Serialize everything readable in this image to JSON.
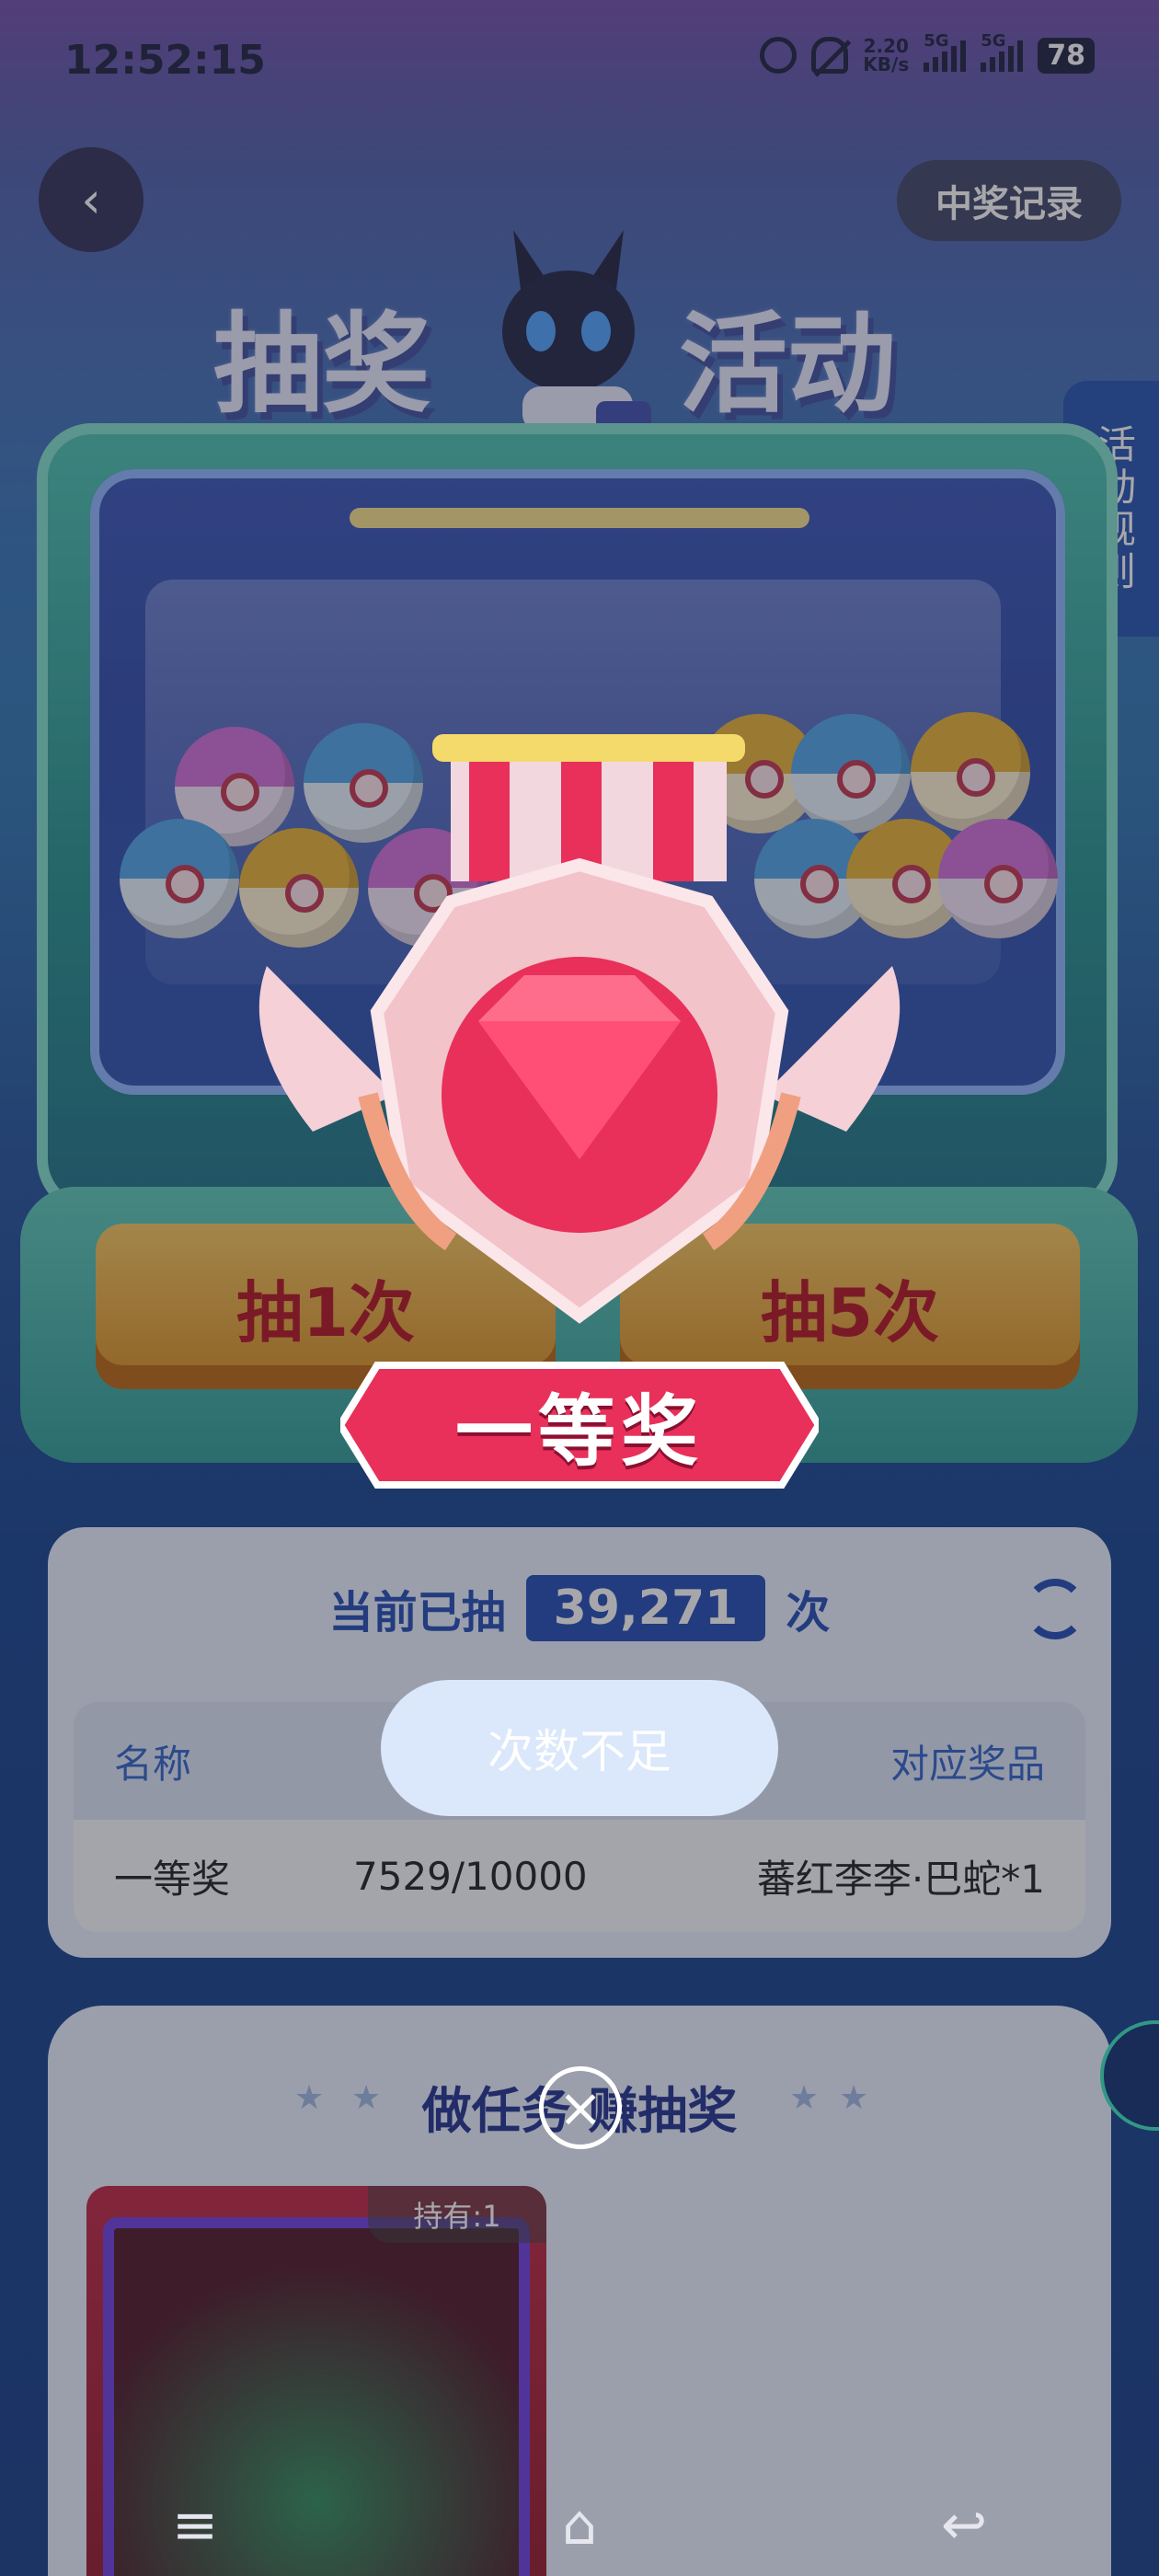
{
  "status_bar": {
    "time": "12:52:15",
    "net_speed": "2.20",
    "net_unit": "KB/s",
    "sig1": "5G",
    "sig2": "5G",
    "battery": "78"
  },
  "header": {
    "back_icon": "chevron-left-icon",
    "records_label": "中奖记录",
    "title_left": "抽奖",
    "title_right": "活动",
    "rules_label": "活动规则"
  },
  "machine": {
    "draw1_label": "抽1次",
    "draw5_label": "抽5次"
  },
  "prize_popup": {
    "prize_name": "一等奖"
  },
  "stats": {
    "prefix": "当前已抽",
    "count": "39,271",
    "suffix": "次"
  },
  "table": {
    "headers": [
      "名称",
      "对应奖品"
    ],
    "rows": [
      {
        "name": "一等奖",
        "progress": "7529/10000",
        "reward": "蕃红李李·巴蛇*1"
      }
    ]
  },
  "toast": {
    "message": "次数不足"
  },
  "task_section": {
    "title": "做任务 赚抽奖",
    "card_hold": "持有:1"
  },
  "nav": {
    "menu": "≡",
    "home": "⌂",
    "back": "↩"
  },
  "colors": {
    "primary": "#1c48b4",
    "accent": "#e8305a"
  }
}
